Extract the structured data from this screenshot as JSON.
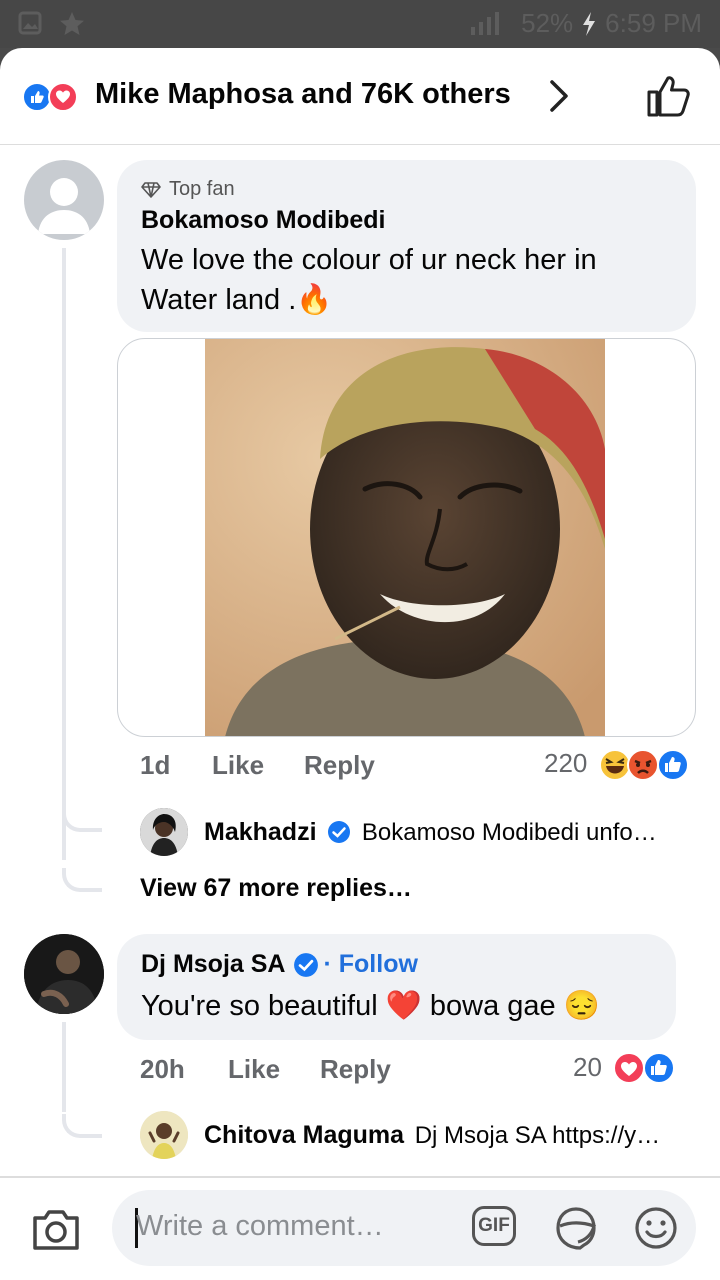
{
  "status_bar": {
    "battery": "52%",
    "time": "6:59 PM"
  },
  "header": {
    "reactions_text": "Mike Maphosa and 76K others",
    "react_types": [
      "like-icon",
      "love-icon"
    ]
  },
  "comment1": {
    "badge": "Top fan",
    "author": "Bokamoso Modibedi",
    "text": "We love the colour of ur neck her in Water land .🔥",
    "time": "1d",
    "like_label": "Like",
    "reply_label": "Reply",
    "reaction_count": "220",
    "reply": {
      "author": "Makhadzi",
      "verified": true,
      "snippet": "Bokamoso Modibedi  unfo…"
    },
    "view_more": "View 67 more replies…"
  },
  "comment2": {
    "author": "Dj Msoja SA",
    "follow_label": "· Follow",
    "text": "You're so beautiful ❤️ bowa gae 😔",
    "time": "20h",
    "like_label": "Like",
    "reply_label": "Reply",
    "reaction_count": "20",
    "reply": {
      "author": "Chitova Maguma",
      "snippet": "Dj Msoja SA https://y…"
    }
  },
  "composer": {
    "placeholder": "Write a comment…",
    "gif_label": "GIF"
  },
  "colors": {
    "fb_blue": "#1877f2",
    "love_red": "#f33e58",
    "bubble_bg": "#f0f2f5",
    "link_blue": "#216fdb"
  }
}
